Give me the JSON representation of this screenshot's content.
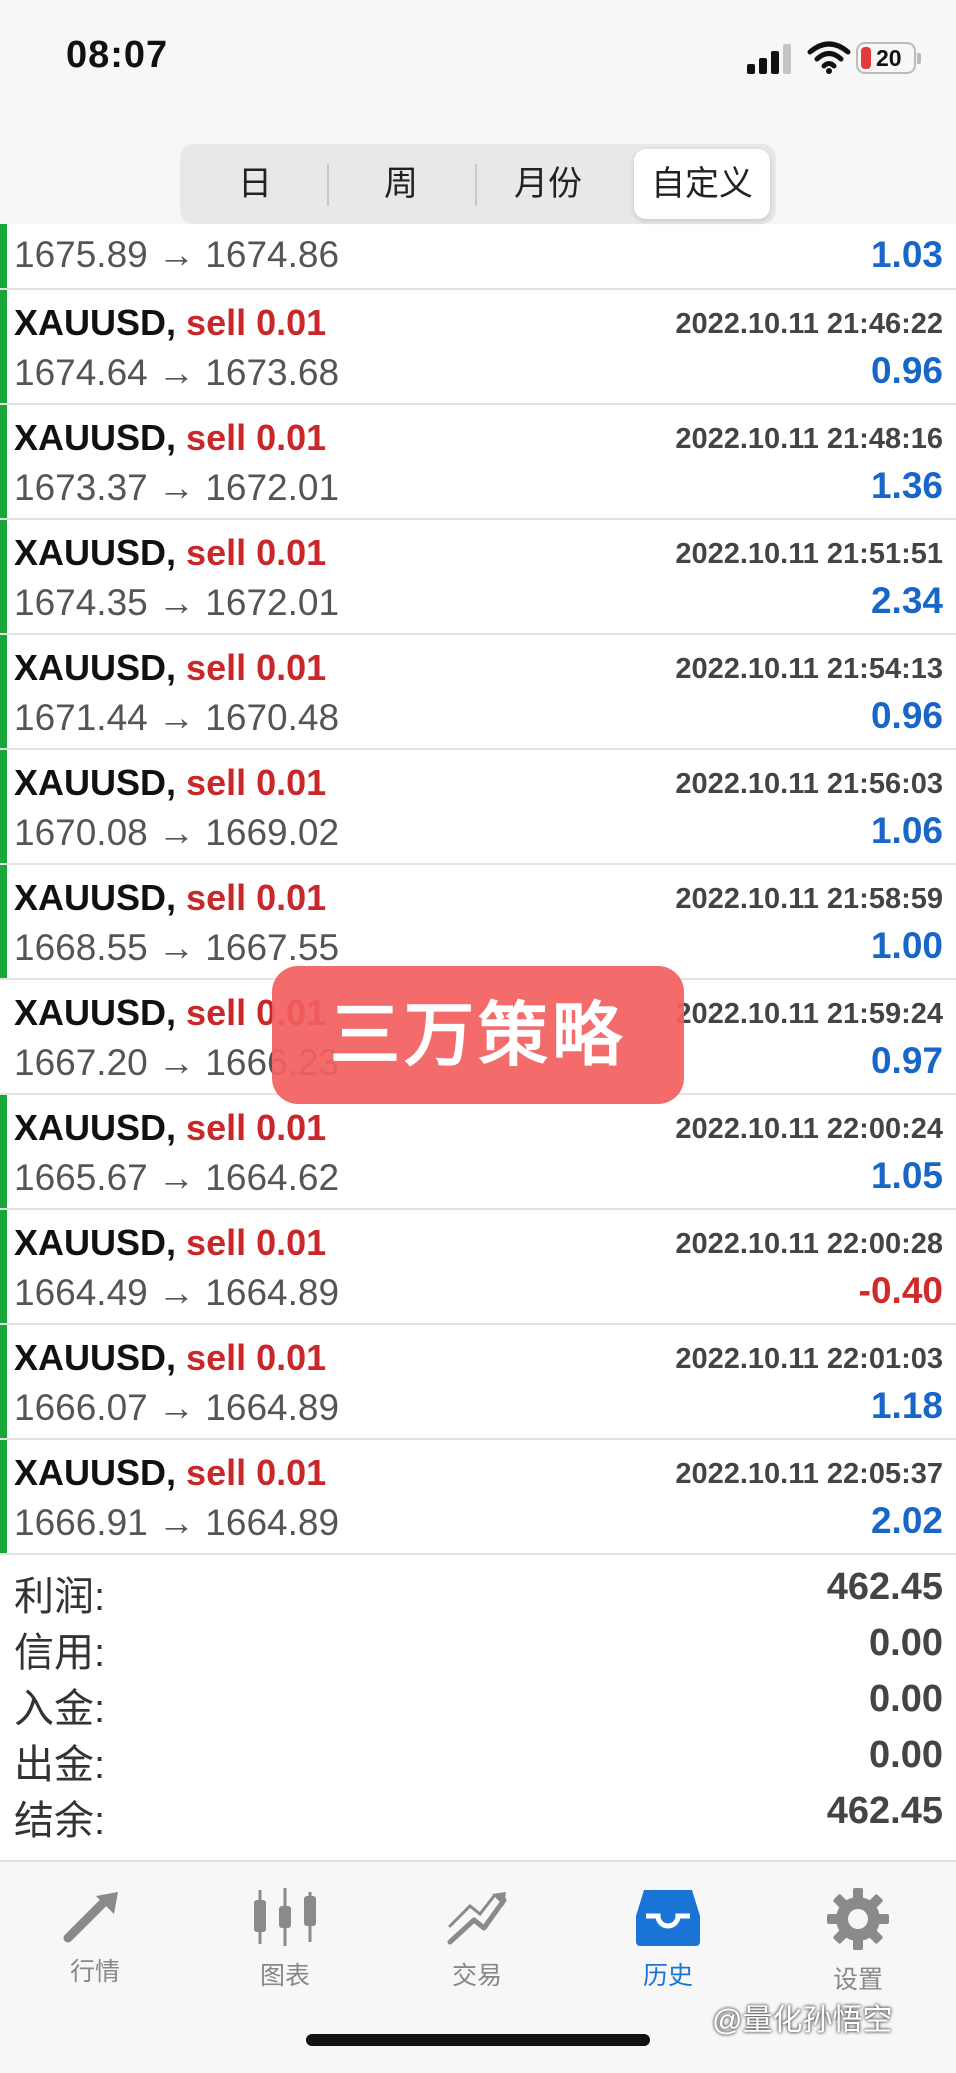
{
  "status_bar": {
    "time": "08:07",
    "battery": "20"
  },
  "tabs": [
    "日",
    "周",
    "月份",
    "自定义"
  ],
  "active_tab": 3,
  "first_row": {
    "prices": "1675.89 → 1674.86",
    "profit": "1.03"
  },
  "trades": [
    {
      "symbol": "XAUUSD,",
      "side": "sell 0.01",
      "time": "2022.10.11 21:46:22",
      "prices": "1674.64 → 1673.68",
      "profit": "0.96"
    },
    {
      "symbol": "XAUUSD,",
      "side": "sell 0.01",
      "time": "2022.10.11 21:48:16",
      "prices": "1673.37 → 1672.01",
      "profit": "1.36"
    },
    {
      "symbol": "XAUUSD,",
      "side": "sell 0.01",
      "time": "2022.10.11 21:51:51",
      "prices": "1674.35 → 1672.01",
      "profit": "2.34"
    },
    {
      "symbol": "XAUUSD,",
      "side": "sell 0.01",
      "time": "2022.10.11 21:54:13",
      "prices": "1671.44 → 1670.48",
      "profit": "0.96"
    },
    {
      "symbol": "XAUUSD,",
      "side": "sell 0.01",
      "time": "2022.10.11 21:56:03",
      "prices": "1670.08 → 1669.02",
      "profit": "1.06"
    },
    {
      "symbol": "XAUUSD,",
      "side": "sell 0.01",
      "time": "2022.10.11 21:58:59",
      "prices": "1668.55 → 1667.55",
      "profit": "1.00"
    },
    {
      "symbol": "XAUUSD,",
      "side": "sell 0.01",
      "time": "2022.10.11 21:59:24",
      "prices": "1667.20 → 1666.23",
      "profit": "0.97"
    },
    {
      "symbol": "XAUUSD,",
      "side": "sell 0.01",
      "time": "2022.10.11 22:00:24",
      "prices": "1665.67 → 1664.62",
      "profit": "1.05"
    },
    {
      "symbol": "XAUUSD,",
      "side": "sell 0.01",
      "time": "2022.10.11 22:00:28",
      "prices": "1664.49 → 1664.89",
      "profit": "-0.40"
    },
    {
      "symbol": "XAUUSD,",
      "side": "sell 0.01",
      "time": "2022.10.11 22:01:03",
      "prices": "1666.07 → 1664.89",
      "profit": "1.18"
    },
    {
      "symbol": "XAUUSD,",
      "side": "sell 0.01",
      "time": "2022.10.11 22:05:37",
      "prices": "1666.91 → 1664.89",
      "profit": "2.02"
    }
  ],
  "summary": [
    {
      "label": "利润:",
      "value": "462.45"
    },
    {
      "label": "信用:",
      "value": "0.00"
    },
    {
      "label": "入金:",
      "value": "0.00"
    },
    {
      "label": "出金:",
      "value": "0.00"
    },
    {
      "label": "结余:",
      "value": "462.45"
    }
  ],
  "tabbar": [
    {
      "label": "行情",
      "icon": "quotes-arrows-icon"
    },
    {
      "label": "图表",
      "icon": "candlestick-chart-icon"
    },
    {
      "label": "交易",
      "icon": "trade-trend-icon"
    },
    {
      "label": "历史",
      "icon": "history-inbox-icon"
    },
    {
      "label": "设置",
      "icon": "gear-icon"
    }
  ],
  "active_tabbar": 3,
  "overlay_label": "三万策略",
  "watermark_credit": "@量化孙悟空",
  "colors": {
    "sell": "#c8282a",
    "profit_positive": "#1966c9",
    "profit_negative": "#d02a2a",
    "row_bar": "#19a837",
    "tab_active": "#1a74d6"
  }
}
